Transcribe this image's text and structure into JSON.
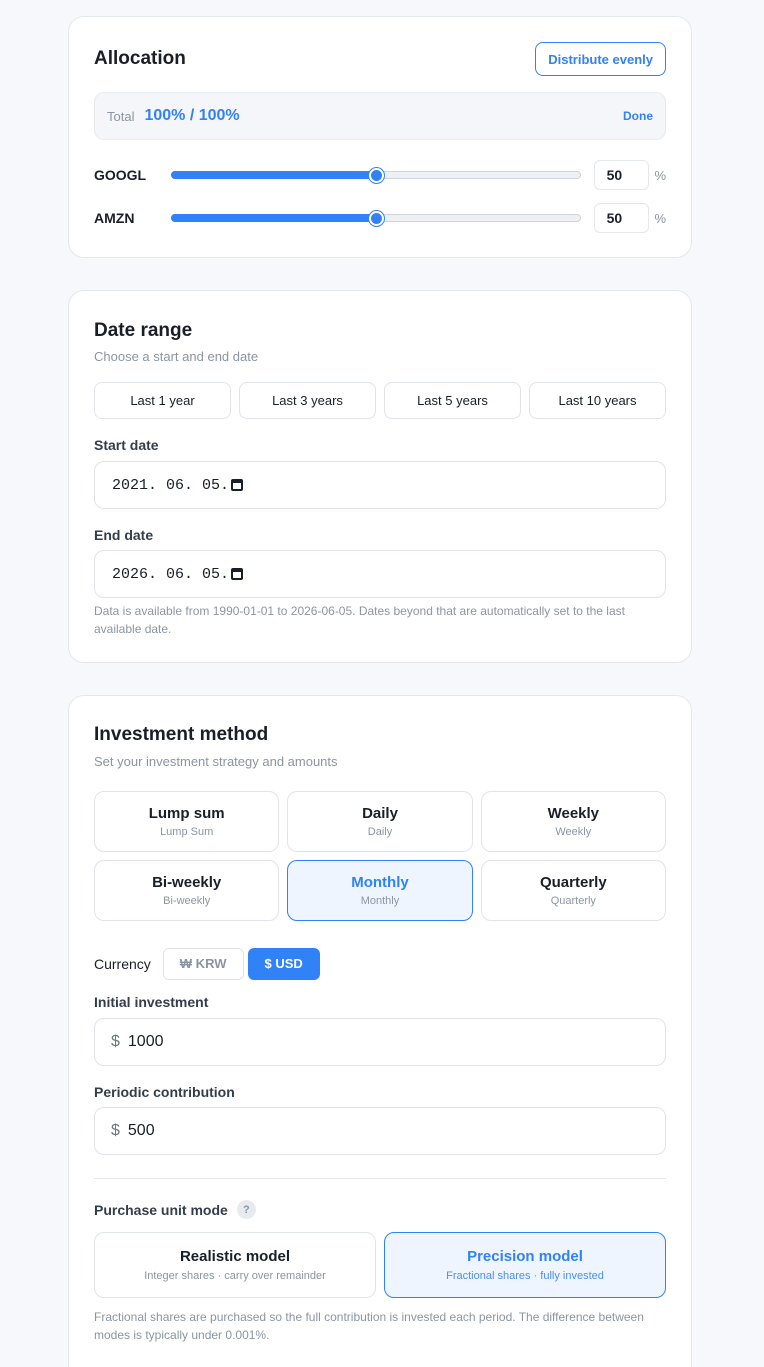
{
  "allocation": {
    "title": "Allocation",
    "distribute_label": "Distribute evenly",
    "total_label": "Total",
    "total_value": "100% / 100%",
    "done_label": "Done",
    "percent_sign": "%",
    "items": [
      {
        "ticker": "GOOGL",
        "value": "50",
        "fraction": 0.5
      },
      {
        "ticker": "AMZN",
        "value": "50",
        "fraction": 0.5
      }
    ]
  },
  "date_range": {
    "title": "Date range",
    "subtitle": "Choose a start and end date",
    "presets": [
      "Last 1 year",
      "Last 3 years",
      "Last 5 years",
      "Last 10 years"
    ],
    "start_label": "Start date",
    "start_value": "2021. 06. 05.",
    "end_label": "End date",
    "end_value": "2026. 06. 05.",
    "note": "Data is available from 1990-01-01 to 2026-06-05. Dates beyond that are automatically set to the last available date."
  },
  "investment": {
    "title": "Investment method",
    "subtitle": "Set your investment strategy and amounts",
    "methods": [
      {
        "title": "Lump sum",
        "sub": "Lump Sum",
        "selected": false
      },
      {
        "title": "Daily",
        "sub": "Daily",
        "selected": false
      },
      {
        "title": "Weekly",
        "sub": "Weekly",
        "selected": false
      },
      {
        "title": "Bi-weekly",
        "sub": "Bi-weekly",
        "selected": false
      },
      {
        "title": "Monthly",
        "sub": "Monthly",
        "selected": true
      },
      {
        "title": "Quarterly",
        "sub": "Quarterly",
        "selected": false
      }
    ],
    "currency_label": "Currency",
    "currency_krw": "₩ KRW",
    "currency_usd": "$ USD",
    "initial_label": "Initial investment",
    "currency_symbol": "$",
    "initial_value": "1000",
    "periodic_label": "Periodic contribution",
    "periodic_value": "500",
    "purchase_mode_label": "Purchase unit mode",
    "help_glyph": "?",
    "models": [
      {
        "title": "Realistic model",
        "sub": "Integer shares · carry over remainder",
        "selected": false
      },
      {
        "title": "Precision model",
        "sub": "Fractional shares · fully invested",
        "selected": true
      }
    ],
    "note": "Fractional shares are purchased so the full contribution is invested each period. The difference between modes is typically under 0.001%."
  },
  "colors": {
    "accent": "#3182f6",
    "selected_bg": "#eef5ff",
    "muted_text": "#8b95a1"
  }
}
